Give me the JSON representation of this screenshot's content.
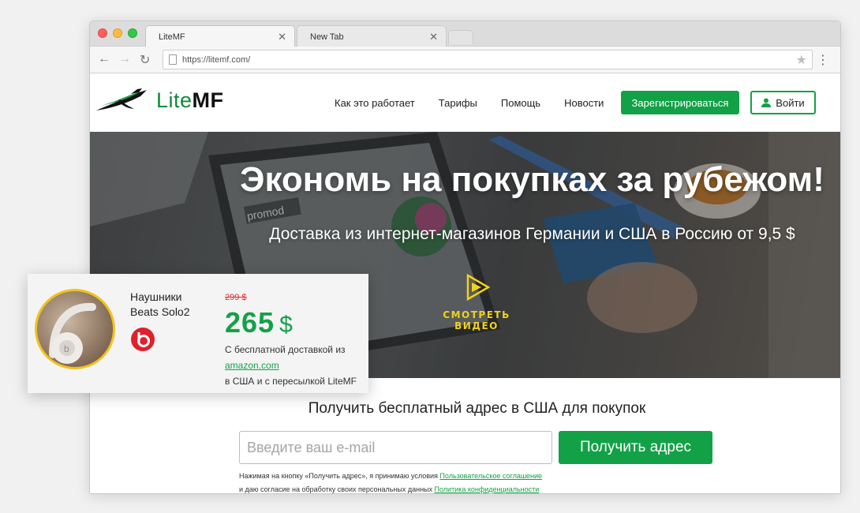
{
  "browser": {
    "tabs": [
      {
        "label": "LiteMF"
      },
      {
        "label": "New Tab"
      }
    ],
    "url": "https://litemf.com/"
  },
  "header": {
    "logo_lite": "Lite",
    "logo_mf": "MF",
    "nav": [
      {
        "label": "Как это работает"
      },
      {
        "label": "Тарифы"
      },
      {
        "label": "Помощь"
      },
      {
        "label": "Новости"
      }
    ],
    "register_label": "Зарегистрироваться",
    "login_label": "Войти"
  },
  "hero": {
    "title": "Экономь на покупках за рубежом!",
    "subtitle": "Доставка из интернет-магазинов Германии и США в Россию от 9,5 $",
    "video_label": "СМОТРЕТЬ ВИДЕО",
    "decor": {
      "promo": "promod"
    }
  },
  "form": {
    "title": "Получить бесплатный адрес в США для покупок",
    "email_placeholder": "Введите ваш e-mail",
    "submit_label": "Получить адрес",
    "terms_line1_prefix": "Нажимая на кнопку «Получить адрес», я принимаю условия ",
    "terms_link1": "Пользовательское соглашение",
    "terms_line2_prefix": "и даю согласие на обработку своих персональных данных ",
    "terms_link2": "Политика конфиденциальности"
  },
  "product_card": {
    "name_line1": "Наушники",
    "name_line2": "Beats Solo2",
    "old_price": "299 $",
    "new_price": "265",
    "currency": "$",
    "desc_line1": "С бесплатной доставкой из",
    "desc_link": "amazon.com",
    "desc_line3": "в США и с пересылкой LiteMF"
  },
  "colors": {
    "brand_green": "#13a148",
    "price_old_red": "#e12b2b",
    "video_yellow": "#f0d21b"
  }
}
